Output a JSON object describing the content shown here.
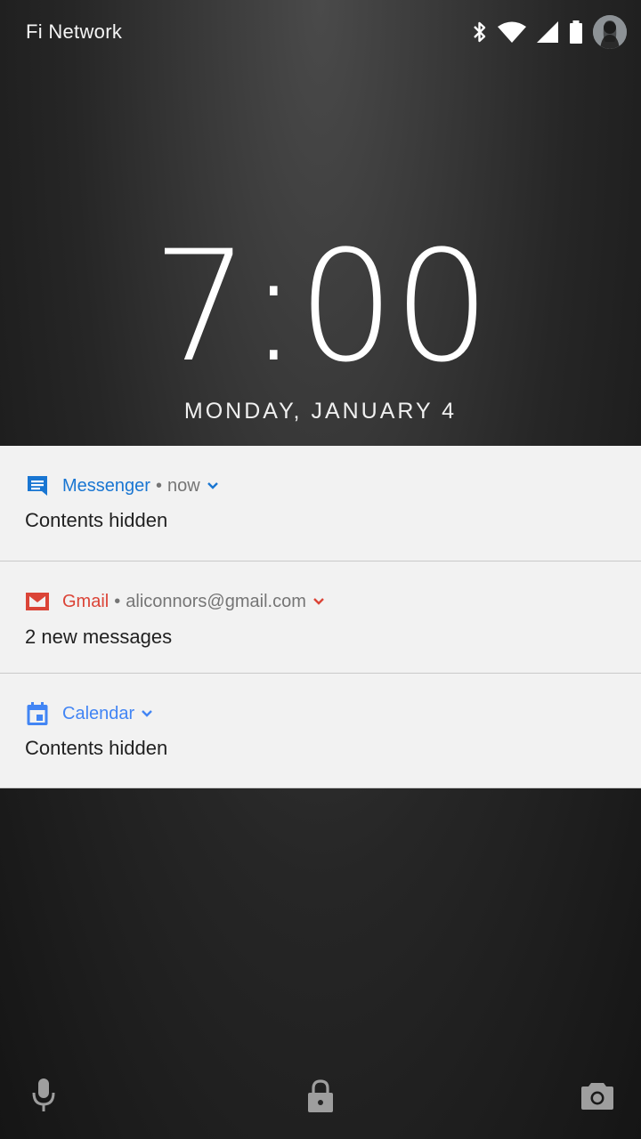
{
  "status_bar": {
    "carrier": "Fi Network",
    "icons": [
      "bluetooth-icon",
      "wifi-icon",
      "signal-icon",
      "battery-icon",
      "avatar"
    ]
  },
  "clock": {
    "time": "7:00",
    "date": "MONDAY, JANUARY 4"
  },
  "notifications": [
    {
      "app": "Messenger",
      "meta": "now",
      "body": "Contents hidden",
      "icon": "messenger-icon",
      "color": "#1976d2"
    },
    {
      "app": "Gmail",
      "meta": "aliconnors@gmail.com",
      "body": "2 new messages",
      "icon": "gmail-icon",
      "color": "#db4437"
    },
    {
      "app": "Calendar",
      "meta": "",
      "body": "Contents hidden",
      "icon": "calendar-icon",
      "color": "#4285f4"
    }
  ],
  "bottom_actions": [
    "microphone-icon",
    "lock-icon",
    "camera-icon"
  ]
}
